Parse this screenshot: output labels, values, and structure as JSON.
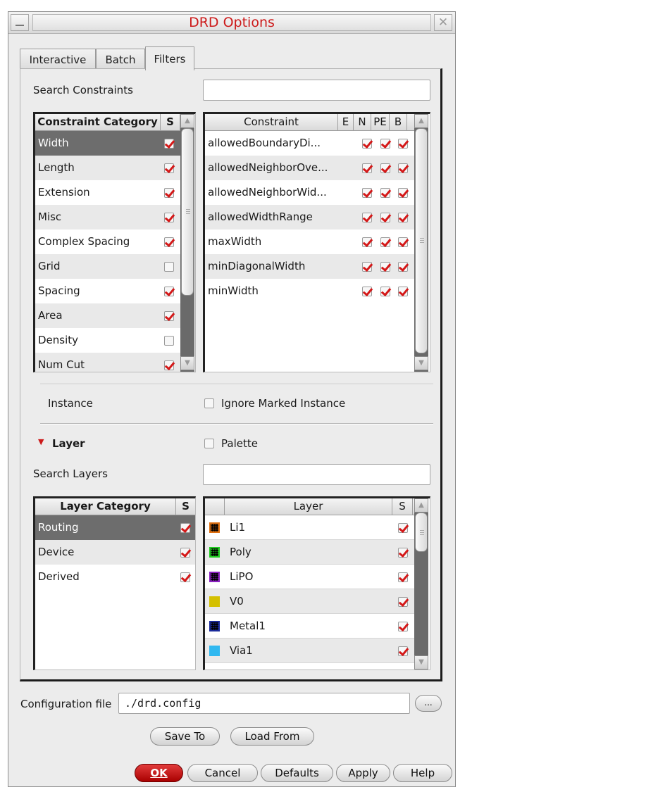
{
  "window": {
    "title": "DRD Options",
    "close_glyph": "✕"
  },
  "tabs": [
    {
      "label": "Interactive"
    },
    {
      "label": "Batch"
    },
    {
      "label": "Filters",
      "active": true
    }
  ],
  "search_constraints": {
    "label": "Search Constraints",
    "value": ""
  },
  "constraint_categories": {
    "headers": {
      "name": "Constraint Category",
      "s": "S"
    },
    "rows": [
      {
        "label": "Width",
        "s": true,
        "selected": true
      },
      {
        "label": "Length",
        "s": true
      },
      {
        "label": "Extension",
        "s": true
      },
      {
        "label": "Misc",
        "s": true
      },
      {
        "label": "Complex Spacing",
        "s": true
      },
      {
        "label": "Grid",
        "s": false
      },
      {
        "label": "Spacing",
        "s": true
      },
      {
        "label": "Area",
        "s": true
      },
      {
        "label": "Density",
        "s": false
      },
      {
        "label": "Num Cut",
        "s": true
      }
    ]
  },
  "constraints": {
    "headers": {
      "name": "Constraint",
      "e": "E",
      "n": "N",
      "pe": "PE",
      "b": "B"
    },
    "rows": [
      {
        "label": "allowedBoundaryDi...",
        "e": false,
        "n": true,
        "pe": true,
        "b": true
      },
      {
        "label": "allowedNeighborOve...",
        "e": false,
        "n": true,
        "pe": true,
        "b": true
      },
      {
        "label": "allowedNeighborWid...",
        "e": false,
        "n": true,
        "pe": true,
        "b": true
      },
      {
        "label": "allowedWidthRange",
        "e": false,
        "n": true,
        "pe": true,
        "b": true
      },
      {
        "label": "maxWidth",
        "e": false,
        "n": true,
        "pe": true,
        "b": true
      },
      {
        "label": "minDiagonalWidth",
        "e": false,
        "n": true,
        "pe": true,
        "b": true
      },
      {
        "label": "minWidth",
        "e": false,
        "n": true,
        "pe": true,
        "b": true
      }
    ]
  },
  "instance": {
    "label": "Instance",
    "ignore_marked_label": "Ignore Marked Instance",
    "ignore_marked": false
  },
  "layer_section": {
    "label": "Layer",
    "expanded": true,
    "palette_label": "Palette",
    "palette": false
  },
  "search_layers": {
    "label": "Search Layers",
    "value": ""
  },
  "layer_categories": {
    "headers": {
      "name": "Layer Category",
      "s": "S"
    },
    "rows": [
      {
        "label": "Routing",
        "s": true,
        "selected": true
      },
      {
        "label": "Device",
        "s": true
      },
      {
        "label": "Derived",
        "s": true
      }
    ]
  },
  "layers": {
    "headers": {
      "name": "Layer",
      "s": "S"
    },
    "rows": [
      {
        "label": "Li1",
        "color": "#e07010",
        "pattern": "dots",
        "s": true
      },
      {
        "label": "Poly",
        "color": "#20cc20",
        "pattern": "dots",
        "s": true
      },
      {
        "label": "LiPO",
        "color": "#8a20c0",
        "pattern": "dots",
        "s": true
      },
      {
        "label": "V0",
        "color": "#d4c000",
        "pattern": "solid",
        "s": true
      },
      {
        "label": "Metal1",
        "color": "#1a2a9a",
        "pattern": "dots",
        "s": true
      },
      {
        "label": "Via1",
        "color": "#30b8f0",
        "pattern": "solid",
        "s": true
      }
    ]
  },
  "config": {
    "label": "Configuration file",
    "value": "./drd.config",
    "browse_label": "..."
  },
  "buttons": {
    "save_to": "Save To",
    "load_from": "Load From",
    "ok": "OK",
    "cancel": "Cancel",
    "defaults": "Defaults",
    "apply": "Apply",
    "help": "Help"
  },
  "colors": {
    "title": "#cc1a1a",
    "check": "#d41818",
    "ok_button": "#c01010",
    "selected_row": "#6d6d6d"
  }
}
